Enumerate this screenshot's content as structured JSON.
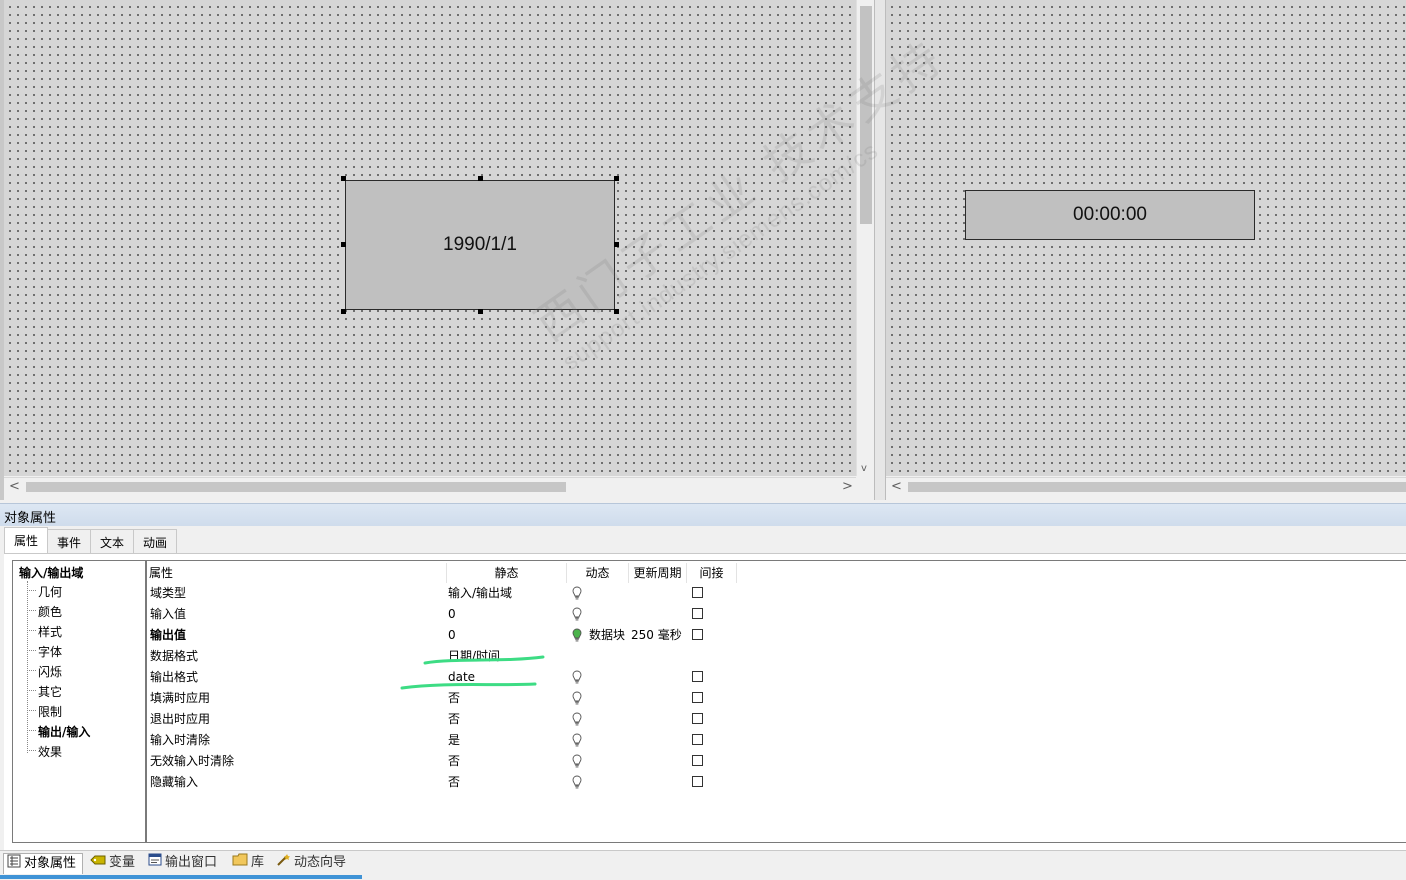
{
  "canvas": {
    "left_field_value": "1990/1/1",
    "right_field_value": "00:00:00",
    "watermark_line1": "西门子工业 技术支持",
    "watermark_line2": "support.industry.siemens.com/cs"
  },
  "scroll_arrows": {
    "left": "<",
    "right": ">",
    "down": "v"
  },
  "properties_panel": {
    "title": "对象属性",
    "tabs": [
      "属性",
      "事件",
      "文本",
      "动画"
    ],
    "active_tab": "属性",
    "tree": {
      "root": "输入/输出域",
      "items": [
        "几何",
        "颜色",
        "样式",
        "字体",
        "闪烁",
        "其它",
        "限制",
        "输出/输入",
        "效果"
      ],
      "selected": "输出/输入"
    },
    "columns": [
      "属性",
      "静态",
      "动态",
      "更新周期",
      "间接"
    ],
    "rows": [
      {
        "name": "域类型",
        "static": "输入/输出域",
        "dynamic": "",
        "cycle": "",
        "bold": false
      },
      {
        "name": "输入值",
        "static": "0",
        "dynamic": "",
        "cycle": "",
        "bold": false
      },
      {
        "name": "输出值",
        "static": "0",
        "dynamic": "数据块",
        "cycle": "250 毫秒",
        "bold": true
      },
      {
        "name": "数据格式",
        "static": "日期/时间",
        "dynamic": "",
        "cycle": "",
        "bold": false
      },
      {
        "name": "输出格式",
        "static": "date",
        "dynamic": "",
        "cycle": "",
        "bold": false
      },
      {
        "name": "填满时应用",
        "static": "否",
        "dynamic": "",
        "cycle": "",
        "bold": false
      },
      {
        "name": "退出时应用",
        "static": "否",
        "dynamic": "",
        "cycle": "",
        "bold": false
      },
      {
        "name": "输入时清除",
        "static": "是",
        "dynamic": "",
        "cycle": "",
        "bold": false
      },
      {
        "name": "无效输入时清除",
        "static": "否",
        "dynamic": "",
        "cycle": "",
        "bold": false
      },
      {
        "name": "隐藏输入",
        "static": "否",
        "dynamic": "",
        "cycle": "",
        "bold": false
      }
    ]
  },
  "bottom_tabs": [
    "对象属性",
    "变量",
    "输出窗口",
    "库",
    "动态向导"
  ],
  "colors": {
    "active_bulb": "#4bb34b",
    "annotation": "#3ddc84",
    "accent": "#3f93d6"
  }
}
